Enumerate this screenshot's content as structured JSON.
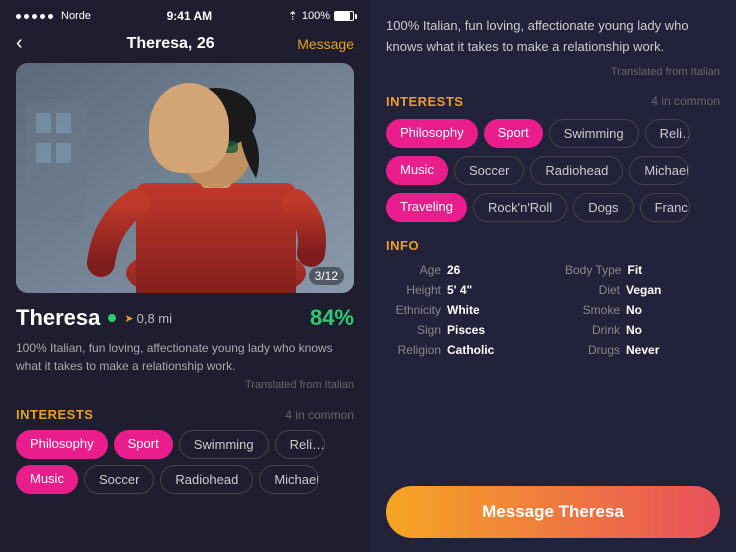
{
  "status_bar": {
    "dots": 5,
    "carrier": "Norde",
    "time": "9:41 AM",
    "battery_pct": "100%"
  },
  "nav": {
    "back_icon": "‹",
    "title": "Theresa, 26",
    "message_link": "Message"
  },
  "profile": {
    "image_counter": "3/12",
    "name": "Theresa",
    "age": "26",
    "distance": "0,8 mi",
    "match_pct": "84%",
    "bio": "100% Italian, fun loving, affectionate young lady who knows what it takes to make a relationship work.",
    "translated": "Translated from Italian"
  },
  "interests": {
    "label": "INTERESTS",
    "common": "4 in common",
    "tags_row1": [
      "Philosophy",
      "Sport",
      "Swimming",
      "Reli…"
    ],
    "tags_row2": [
      "Music",
      "Soccer",
      "Radiohead",
      "Michael B…"
    ],
    "tags_row3": [
      "Traveling",
      "Rock'n'Roll",
      "Dogs",
      "Franc…"
    ],
    "pink_tags": [
      "Philosophy",
      "Sport",
      "Music",
      "Traveling"
    ]
  },
  "info": {
    "label": "INFO",
    "fields": [
      {
        "key": "Age",
        "val": "26"
      },
      {
        "key": "Height",
        "val": "5' 4\""
      },
      {
        "key": "Ethnicity",
        "val": "White"
      },
      {
        "key": "Sign",
        "val": "Pisces"
      },
      {
        "key": "Religion",
        "val": "Catholic"
      },
      {
        "key": "Body Type",
        "val": "Fit"
      },
      {
        "key": "Diet",
        "val": "Vegan"
      },
      {
        "key": "Smoke",
        "val": "No"
      },
      {
        "key": "Drink",
        "val": "No"
      },
      {
        "key": "Drugs",
        "val": "Never"
      }
    ]
  },
  "cta": {
    "label": "Message Theresa"
  }
}
